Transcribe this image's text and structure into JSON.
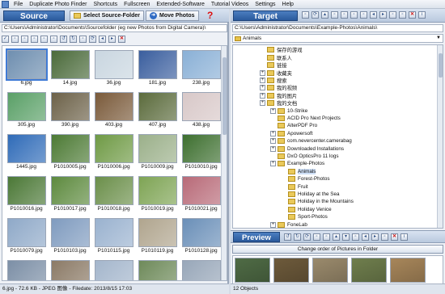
{
  "menu": [
    "File",
    "Duplicate Photo Finder",
    "Shortcuts",
    "Fullscreen",
    "Extended-Software",
    "Tutorial Videos",
    "Settings",
    "Help"
  ],
  "source": {
    "title": "Source",
    "select_btn": "Select Source-Folder",
    "move_btn": "Move Photos",
    "help": "?",
    "path": "C:\\Users\\Administrator\\Documents\\Sourcefolder (eg new Photos from Digital Camera)\\",
    "toolbar_icons": [
      "check-all-icon",
      "uncheck-icon",
      "invert-icon",
      "copy-icon",
      "paste-icon",
      "grid-icon",
      "rotate-left-icon",
      "rotate-right-icon",
      "view-icon",
      "refresh-icon",
      "prev-icon",
      "next-icon",
      "delete-icon"
    ],
    "thumbs": [
      {
        "name": "6.jpg",
        "color": "#6f8fb0"
      },
      {
        "name": "14.jpg",
        "color": "#4a6a3a"
      },
      {
        "name": "36.jpg",
        "color": "#c9d6e0"
      },
      {
        "name": "181.jpg",
        "color": "#3a5e9e"
      },
      {
        "name": "238.jpg",
        "color": "#8ab0d6"
      },
      {
        "name": "305.jpg",
        "color": "#5aa067"
      },
      {
        "name": "390.jpg",
        "color": "#6c6148"
      },
      {
        "name": "403.jpg",
        "color": "#7a5a3a"
      },
      {
        "name": "407.jpg",
        "color": "#5b6b3c"
      },
      {
        "name": "438.jpg",
        "color": "#d8c8c8"
      },
      {
        "name": "1445.jpg",
        "color": "#2f6bb8"
      },
      {
        "name": "P1010005.jpg",
        "color": "#4c7a34"
      },
      {
        "name": "P1010006.jpg",
        "color": "#6f9a45"
      },
      {
        "name": "P1010009.jpg",
        "color": "#9bb08a"
      },
      {
        "name": "P1010010.jpg",
        "color": "#3d6f2f"
      },
      {
        "name": "P1010016.jpg",
        "color": "#4b7836"
      },
      {
        "name": "P1010017.jpg",
        "color": "#5d8a3e"
      },
      {
        "name": "P1010018.jpg",
        "color": "#6b8f4a"
      },
      {
        "name": "P1010019.jpg",
        "color": "#7ea454"
      },
      {
        "name": "P1010021.jpg",
        "color": "#b86a78"
      },
      {
        "name": "P1010079.jpg",
        "color": "#8fa9c8"
      },
      {
        "name": "P1010103.jpg",
        "color": "#7f9bbf"
      },
      {
        "name": "P1010115.jpg",
        "color": "#9ab2cf"
      },
      {
        "name": "P1010119.jpg",
        "color": "#b0a58e"
      },
      {
        "name": "P1010128.jpg",
        "color": "#6a8fb8"
      },
      {
        "name": "",
        "color": "#7c8fa6"
      },
      {
        "name": "",
        "color": "#8b7a66"
      },
      {
        "name": "",
        "color": "#a4b6cc"
      },
      {
        "name": "",
        "color": "#6e8a5a"
      },
      {
        "name": "",
        "color": "#98a7b9"
      }
    ],
    "status": "6.jpg - 72.6 KB - JPEG 图像 - Filedate: 2013/8/15 17:03"
  },
  "target": {
    "title": "Target",
    "path": "C:\\Users\\Administrator\\Documents\\Example-Photos\\Animals\\",
    "combo_value": "Animals",
    "toolbar_icons": [
      "home-icon",
      "refresh-icon",
      "up-icon",
      "new-folder-icon",
      "copy-icon",
      "paste-icon",
      "rename-icon",
      "back-icon",
      "forward-icon",
      "sort-icon",
      "filter-icon",
      "delete-icon",
      "info-icon"
    ],
    "tree": [
      {
        "label": "保存的游戏",
        "level": 3,
        "exp": false
      },
      {
        "label": "联系人",
        "level": 3,
        "exp": false
      },
      {
        "label": "链接",
        "level": 3,
        "exp": false
      },
      {
        "label": "收藏夹",
        "level": 3,
        "exp": true
      },
      {
        "label": "搜索",
        "level": 3,
        "exp": true
      },
      {
        "label": "我的视频",
        "level": 3,
        "exp": true
      },
      {
        "label": "我的图片",
        "level": 3,
        "exp": true
      },
      {
        "label": "我的文档",
        "level": 3,
        "exp": true
      },
      {
        "label": "10-Strike",
        "level": 4,
        "exp": true
      },
      {
        "label": "ACID Pro Next Projects",
        "level": 4,
        "exp": false
      },
      {
        "label": "AlterPDF Pro",
        "level": 4,
        "exp": false
      },
      {
        "label": "Apowersoft",
        "level": 4,
        "exp": true
      },
      {
        "label": "com.nevercenter.camerabag",
        "level": 4,
        "exp": true
      },
      {
        "label": "Downloaded Installations",
        "level": 4,
        "exp": true
      },
      {
        "label": "DxO OpticsPro 11 logs",
        "level": 4,
        "exp": false
      },
      {
        "label": "Example-Photos",
        "level": 4,
        "exp": true
      },
      {
        "label": "Animals",
        "level": 5,
        "exp": false,
        "sel": true
      },
      {
        "label": "Forest-Photos",
        "level": 5,
        "exp": false
      },
      {
        "label": "Fruit",
        "level": 5,
        "exp": false
      },
      {
        "label": "Holiday at the Sea",
        "level": 5,
        "exp": false
      },
      {
        "label": "Holiday in the Mountains",
        "level": 5,
        "exp": false
      },
      {
        "label": "Holiday Venice",
        "level": 5,
        "exp": false
      },
      {
        "label": "Sport-Photos",
        "level": 5,
        "exp": false
      },
      {
        "label": "FoneLab",
        "level": 4,
        "exp": true
      }
    ]
  },
  "preview": {
    "title": "Preview",
    "order_btn": "Change order of Pictures in Folder",
    "toolbar_icons": [
      "rotate-left-icon",
      "rotate-right-icon",
      "refresh-icon",
      "copy-icon",
      "paste-icon",
      "up-icon",
      "down-icon",
      "view-icon",
      "back-icon",
      "forward-icon",
      "sort-icon",
      "delete-icon",
      "info-icon"
    ],
    "thumbs": [
      {
        "color": "#4f6b45"
      },
      {
        "color": "#6d5a3b"
      },
      {
        "color": "#9a8a6c"
      },
      {
        "color": "#6f7e4d"
      },
      {
        "color": "#a7865a"
      }
    ],
    "status": "12 Objects"
  }
}
